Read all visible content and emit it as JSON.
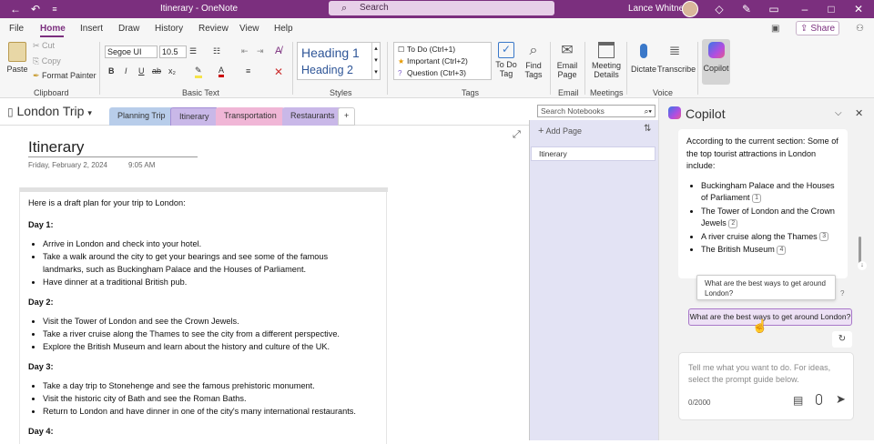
{
  "titlebar": {
    "title": "Itinerary - OneNote",
    "search_placeholder": "Search",
    "user_name": "Lance Whitney"
  },
  "menu": {
    "items": [
      "File",
      "Home",
      "Insert",
      "Draw",
      "History",
      "Review",
      "View",
      "Help"
    ],
    "active": "Home",
    "share_label": "Share"
  },
  "ribbon": {
    "paste": "Paste",
    "cut": "Cut",
    "copy": "Copy",
    "format_painter": "Format Painter",
    "font_name": "Segoe UI",
    "font_size": "10.5",
    "style_h1": "Heading 1",
    "style_h2": "Heading 2",
    "tags": [
      "To Do (Ctrl+1)",
      "Important (Ctrl+2)",
      "Question (Ctrl+3)"
    ],
    "todo_tag": "To Do Tag",
    "find_tags": "Find Tags",
    "email_page": "Email Page",
    "meeting_details": "Meeting Details",
    "dictate": "Dictate",
    "transcribe": "Transcribe",
    "copilot": "Copilot",
    "groups": {
      "clipboard": "Clipboard",
      "basic_text": "Basic Text",
      "styles": "Styles",
      "tags": "Tags",
      "email": "Email",
      "meetings": "Meetings",
      "voice": "Voice"
    }
  },
  "notebook": {
    "name": "London Trip",
    "sections": [
      {
        "label": "Planning Trip",
        "color": "#b8cdea"
      },
      {
        "label": "Itinerary",
        "color": "#c9b8e8"
      },
      {
        "label": "Transportation",
        "color": "#f0b6d6"
      },
      {
        "label": "Restaurants",
        "color": "#c9b8e8"
      }
    ],
    "add_section": "+",
    "search_placeholder": "Search Notebooks"
  },
  "pages_panel": {
    "add_page": "Add Page",
    "pages": [
      "Itinerary"
    ]
  },
  "page": {
    "title": "Itinerary",
    "date": "Friday, February 2, 2024",
    "time": "9:05 AM",
    "intro": "Here is a draft plan for your trip to London:",
    "days": [
      {
        "label": "Day 1:",
        "items": [
          "Arrive in London and check into your hotel.",
          "Take a walk around the city to get your bearings and see some of the famous landmarks, such as Buckingham Palace and the Houses of Parliament.",
          "Have dinner at a traditional British pub."
        ]
      },
      {
        "label": "Day 2:",
        "items": [
          "Visit the Tower of London and see the Crown Jewels.",
          "Take a river cruise along the Thames to see the city from a different perspective.",
          "Explore the British Museum and learn about the history and culture of the UK."
        ]
      },
      {
        "label": "Day 3:",
        "items": [
          "Take a day trip to Stonehenge and see the famous prehistoric monument.",
          "Visit the historic city of Bath and see the Roman Baths.",
          "Return to London and have dinner in one of the city's many international restaurants."
        ]
      },
      {
        "label": "Day 4:",
        "items": []
      }
    ]
  },
  "copilot": {
    "title": "Copilot",
    "response_intro": "According to the current section: Some of the top tourist attractions in London include:",
    "attractions": [
      {
        "text": "Buckingham Palace and the Houses of Parliament",
        "cite": "1"
      },
      {
        "text": "The Tower of London and the Crown Jewels",
        "cite": "2"
      },
      {
        "text": "A river cruise along the Thames",
        "cite": "3"
      },
      {
        "text": "The British Museum",
        "cite": "4"
      }
    ],
    "tooltip": "What are the best ways to get around London?",
    "suggestion": "What are the best ways to get around London?",
    "input_placeholder": "Tell me what you want to do. For ideas, select the prompt guide below.",
    "counter": "0/2000"
  }
}
